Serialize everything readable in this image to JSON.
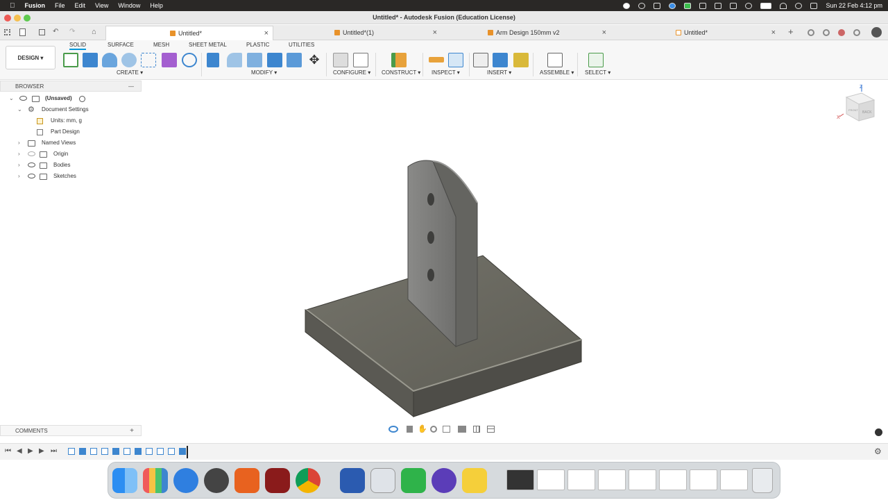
{
  "menubar": {
    "app_name": "Fusion",
    "items": [
      "File",
      "Edit",
      "View",
      "Window",
      "Help"
    ],
    "datetime": "Sun 22 Feb  4:12 pm"
  },
  "window": {
    "title": "Untitled* - Autodesk Fusion (Education License)"
  },
  "tabs": [
    {
      "label": "Untitled*",
      "active": true
    },
    {
      "label": "Untitled*(1)",
      "active": false
    },
    {
      "label": "Arm Design 150mm v2",
      "active": false
    },
    {
      "label": "Untitled*",
      "active": false
    }
  ],
  "toolbar": {
    "workspace": "DESIGN",
    "tabs": [
      "SOLID",
      "SURFACE",
      "MESH",
      "SHEET METAL",
      "PLASTIC",
      "UTILITIES"
    ],
    "groups": [
      "CREATE",
      "MODIFY",
      "CONFIGURE",
      "CONSTRUCT",
      "INSPECT",
      "INSERT",
      "ASSEMBLE",
      "SELECT"
    ]
  },
  "browser": {
    "title": "BROWSER",
    "root": "(Unsaved)",
    "items": [
      {
        "label": "Document Settings"
      },
      {
        "label": "Units: mm, g"
      },
      {
        "label": "Part Design"
      },
      {
        "label": "Named Views"
      },
      {
        "label": "Origin"
      },
      {
        "label": "Bodies"
      },
      {
        "label": "Sketches"
      }
    ]
  },
  "viewcube": {
    "labels": [
      "FRONT",
      "BACK"
    ]
  },
  "comments": {
    "title": "COMMENTS"
  },
  "colors": {
    "accent": "#0696d7",
    "model_body": "#6b6a62",
    "model_dark": "#4c4b45",
    "menubar_bg": "#2a2826"
  }
}
